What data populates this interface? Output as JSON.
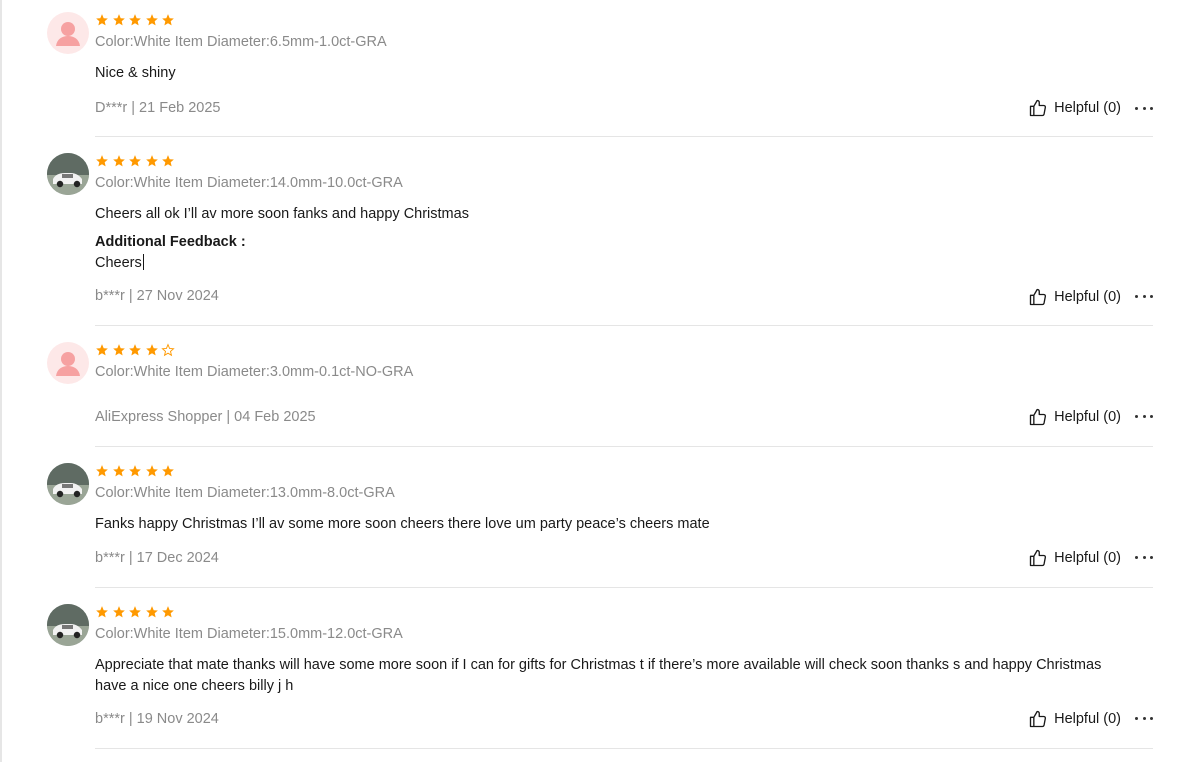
{
  "colors": {
    "star": "#ff9900",
    "muted": "#8a8a8a",
    "text": "#191919"
  },
  "reviews": [
    {
      "avatar": "default-avatar-icon",
      "rating": 5,
      "sku": "Color:White Item Diameter:6.5mm-1.0ct-GRA",
      "text": "Nice & shiny",
      "meta": "D***r | 21 Feb 2025",
      "helpful": "Helpful (0)"
    },
    {
      "avatar": "car-photo-avatar",
      "rating": 5,
      "sku": "Color:White Item Diameter:14.0mm-10.0ct-GRA",
      "text": "Cheers all ok I’ll av more soon fanks and happy Christmas",
      "additional_title": "Additional Feedback :",
      "additional_text": "Cheers",
      "meta": "b***r | 27 Nov 2024",
      "helpful": "Helpful (0)"
    },
    {
      "avatar": "default-avatar-icon",
      "rating": 4,
      "sku": "Color:White Item Diameter:3.0mm-0.1ct-NO-GRA",
      "meta": "AliExpress Shopper | 04 Feb 2025",
      "helpful": "Helpful (0)"
    },
    {
      "avatar": "car-photo-avatar",
      "rating": 5,
      "sku": "Color:White Item Diameter:13.0mm-8.0ct-GRA",
      "text": "Fanks happy Christmas I’ll av some more soon cheers there love um party peace’s cheers mate",
      "meta": "b***r | 17 Dec 2024",
      "helpful": "Helpful (0)"
    },
    {
      "avatar": "car-photo-avatar",
      "rating": 5,
      "sku": "Color:White Item Diameter:15.0mm-12.0ct-GRA",
      "text": "Appreciate that mate thanks will have some more soon if I can for gifts for Christmas t if there’s more available will check soon thanks s and happy Christmas have a nice one cheers billy j h",
      "meta": "b***r | 19 Nov 2024",
      "helpful": "Helpful (0)"
    }
  ]
}
